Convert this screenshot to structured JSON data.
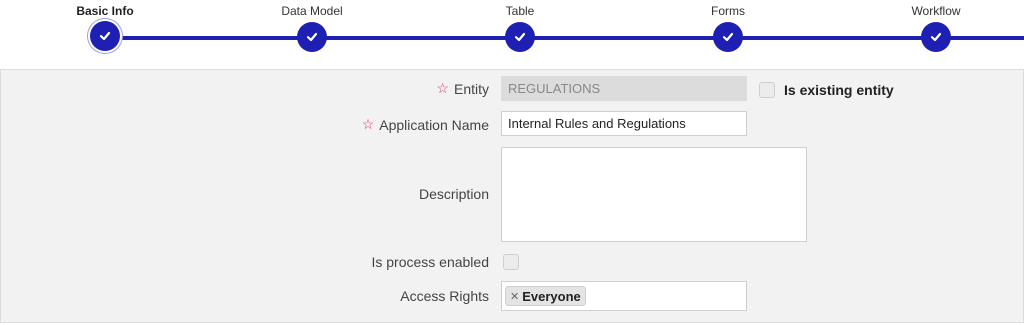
{
  "stepper": {
    "steps": [
      {
        "label": "Basic Info",
        "state": "active"
      },
      {
        "label": "Data Model",
        "state": "complete"
      },
      {
        "label": "Table",
        "state": "complete"
      },
      {
        "label": "Forms",
        "state": "complete"
      },
      {
        "label": "Workflow",
        "state": "complete"
      }
    ],
    "check_icon": "checkmark-icon",
    "line_color": "#1e1fb3"
  },
  "form": {
    "entity": {
      "label": "Entity",
      "required": true,
      "value": "REGULATIONS",
      "disabled": true
    },
    "is_existing_entity": {
      "label": "Is existing entity",
      "checked": false
    },
    "application_name": {
      "label": "Application Name",
      "required": true,
      "value": "Internal Rules and Regulations"
    },
    "description": {
      "label": "Description",
      "value": ""
    },
    "is_process_enabled": {
      "label": "Is process enabled",
      "checked": false
    },
    "access_rights": {
      "label": "Access Rights",
      "tags": [
        {
          "label": "Everyone",
          "remove_icon": "close-icon"
        }
      ]
    },
    "required_icon": "star-outline-icon",
    "required_color": "#e0307a"
  }
}
